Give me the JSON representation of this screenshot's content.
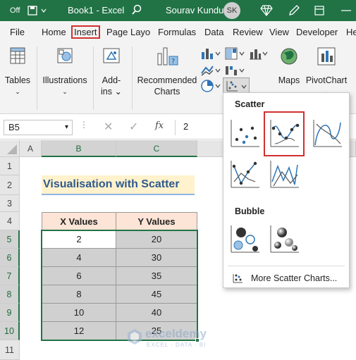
{
  "titlebar": {
    "autosave_state": "Off",
    "document_title": "Book1 - Excel",
    "user_name": "Sourav Kundu",
    "user_initials": "SK"
  },
  "tabs": [
    {
      "label": "File"
    },
    {
      "label": "Home"
    },
    {
      "label": "Insert"
    },
    {
      "label": "Page Layout"
    },
    {
      "label": "Formulas"
    },
    {
      "label": "Data"
    },
    {
      "label": "Review"
    },
    {
      "label": "View"
    },
    {
      "label": "Developer"
    },
    {
      "label": "He"
    }
  ],
  "ribbon": {
    "tables": "Tables",
    "illustrations": "Illustrations",
    "addins_line1": "Add-",
    "addins_line2": "ins",
    "recommended_line1": "Recommended",
    "recommended_line2": "Charts",
    "maps": "Maps",
    "pivotchart": "PivotChart"
  },
  "formula_bar": {
    "name_box": "B5",
    "fx": "fx",
    "value": "2"
  },
  "sheet": {
    "columns": [
      "A",
      "B",
      "C"
    ],
    "rows": [
      "1",
      "2",
      "3",
      "4",
      "5",
      "6",
      "7",
      "8",
      "9",
      "10",
      "11"
    ],
    "title": "Visualisation with Scatter",
    "headers": [
      "X Values",
      "Y Values"
    ],
    "data": [
      [
        "2",
        "20"
      ],
      [
        "4",
        "30"
      ],
      [
        "6",
        "35"
      ],
      [
        "8",
        "45"
      ],
      [
        "10",
        "40"
      ],
      [
        "12",
        "25"
      ]
    ]
  },
  "dropdown": {
    "scatter_heading": "Scatter",
    "bubble_heading": "Bubble",
    "more_link": "More Scatter Charts..."
  },
  "watermark": {
    "name": "exceldemy",
    "tagline": "EXCEL · DATA · BI"
  },
  "colors": {
    "excel_green": "#217346",
    "highlight_red": "#d0302f",
    "header_fill": "#fce4d6",
    "title_fill": "#fff2cc",
    "title_text": "#2e5a8e",
    "data_fill": "#d0d0d0"
  }
}
